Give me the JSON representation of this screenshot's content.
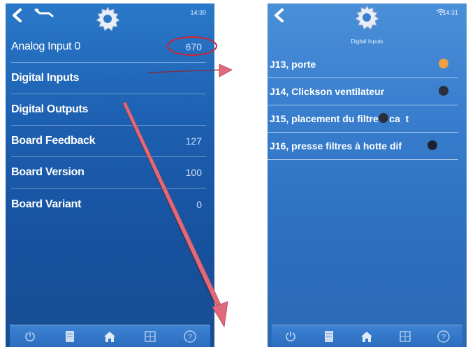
{
  "left_screen": {
    "clock": "14:30",
    "rows": [
      {
        "label": "Analog Input 0",
        "value": "670"
      },
      {
        "label": "Digital Inputs",
        "value": ""
      },
      {
        "label": "Digital Outputs",
        "value": ""
      },
      {
        "label": "Board Feedback",
        "value": "127"
      },
      {
        "label": "Board Version",
        "value": "100"
      },
      {
        "label": "Board Variant",
        "value": "0"
      }
    ]
  },
  "right_screen": {
    "clock": "14:31",
    "subtitle": "Digital Inputs",
    "inputs": [
      {
        "label": "J13, porte",
        "state_color": "#f0a040"
      },
      {
        "label": "J14, Clickson ventilateur",
        "state_color": "#2a2f3a"
      },
      {
        "label": "J15, placement du filtre à ca  t",
        "state_color": "#2a2f3a"
      },
      {
        "label": "J16, presse filtres à hotte dif",
        "state_color": "#1e2230"
      }
    ]
  },
  "icons": {
    "back": "chevron-left-icon",
    "tools": "wrench-icon",
    "settings": "gear-icon",
    "wifi": "wifi-icon",
    "nav": [
      "power-icon",
      "document-icon",
      "home-icon",
      "grid-icon",
      "help-icon"
    ]
  },
  "colors": {
    "annotation_red": "#d8202a",
    "arrow_fill": "#e0697a",
    "led_active": "#f0a040",
    "led_inactive": "#2a2f3a"
  }
}
